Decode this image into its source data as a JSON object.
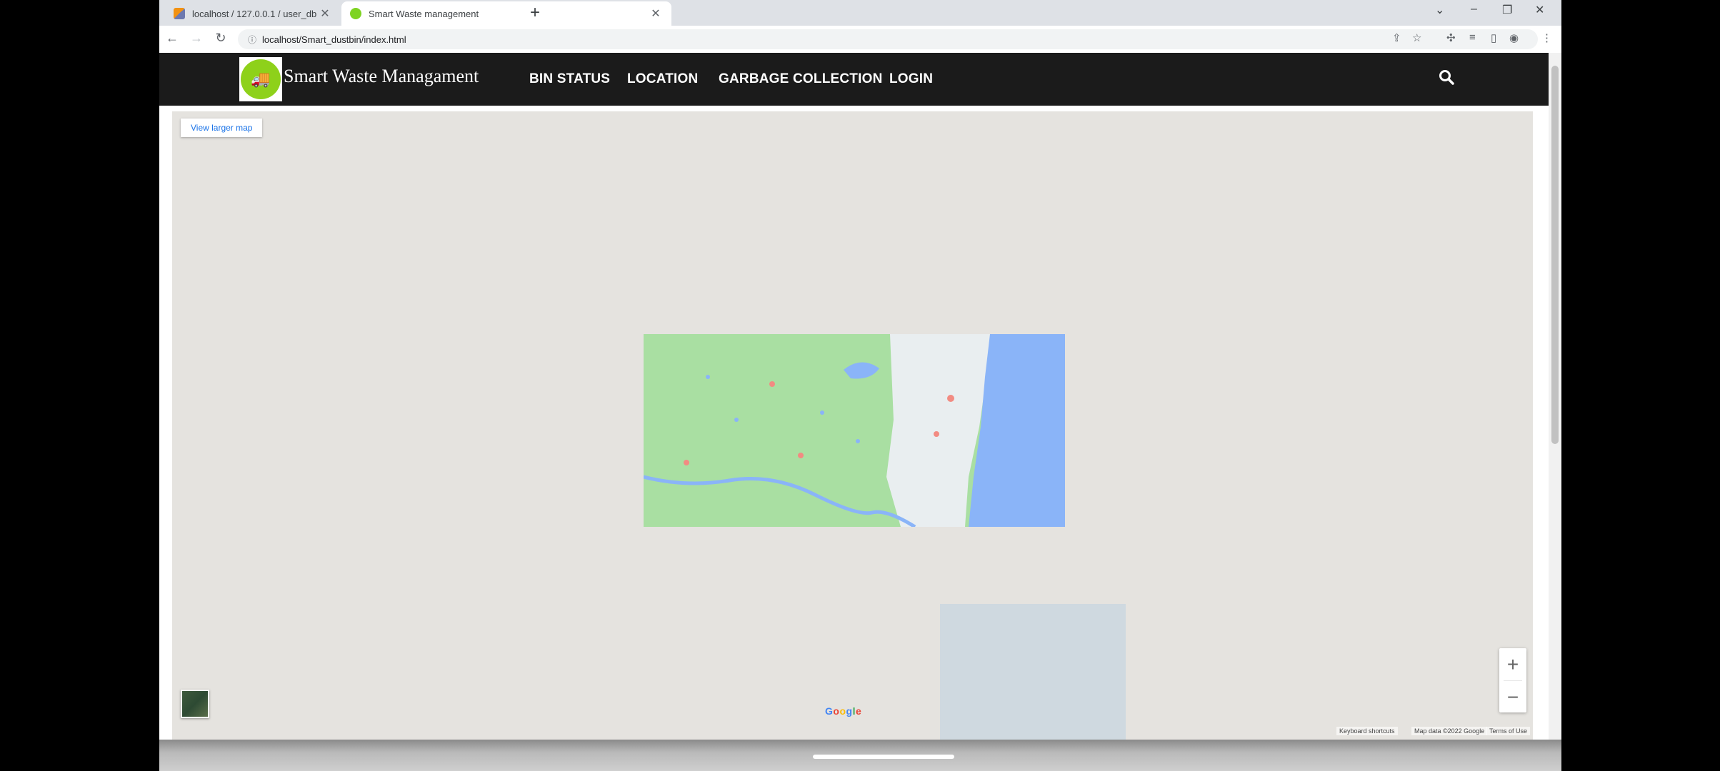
{
  "browser": {
    "tabs": [
      {
        "title": "localhost / 127.0.0.1 / user_db / ...",
        "active": false
      },
      {
        "title": "Smart Waste management",
        "active": true
      }
    ],
    "new_tab": "+",
    "address": "localhost/Smart_dustbin/index.html"
  },
  "site": {
    "brand": "Smart Waste Managament",
    "nav": {
      "bin_status": "BIN STATUS",
      "location": "LOCATION",
      "garbage_collection": "GARBAGE COLLECTION",
      "login": "LOGIN"
    }
  },
  "map": {
    "view_larger": "View larger map",
    "zoom_in": "+",
    "zoom_out": "−",
    "google": "Google",
    "attribution": {
      "shortcuts": "Keyboard shortcuts",
      "data": "Map data ©2022 Google",
      "terms": "Terms of Use"
    },
    "colors": {
      "land": "#a9dfa2",
      "urban": "#e9eef0",
      "sea": "#8ab4f8",
      "background": "#e5e3df"
    }
  }
}
